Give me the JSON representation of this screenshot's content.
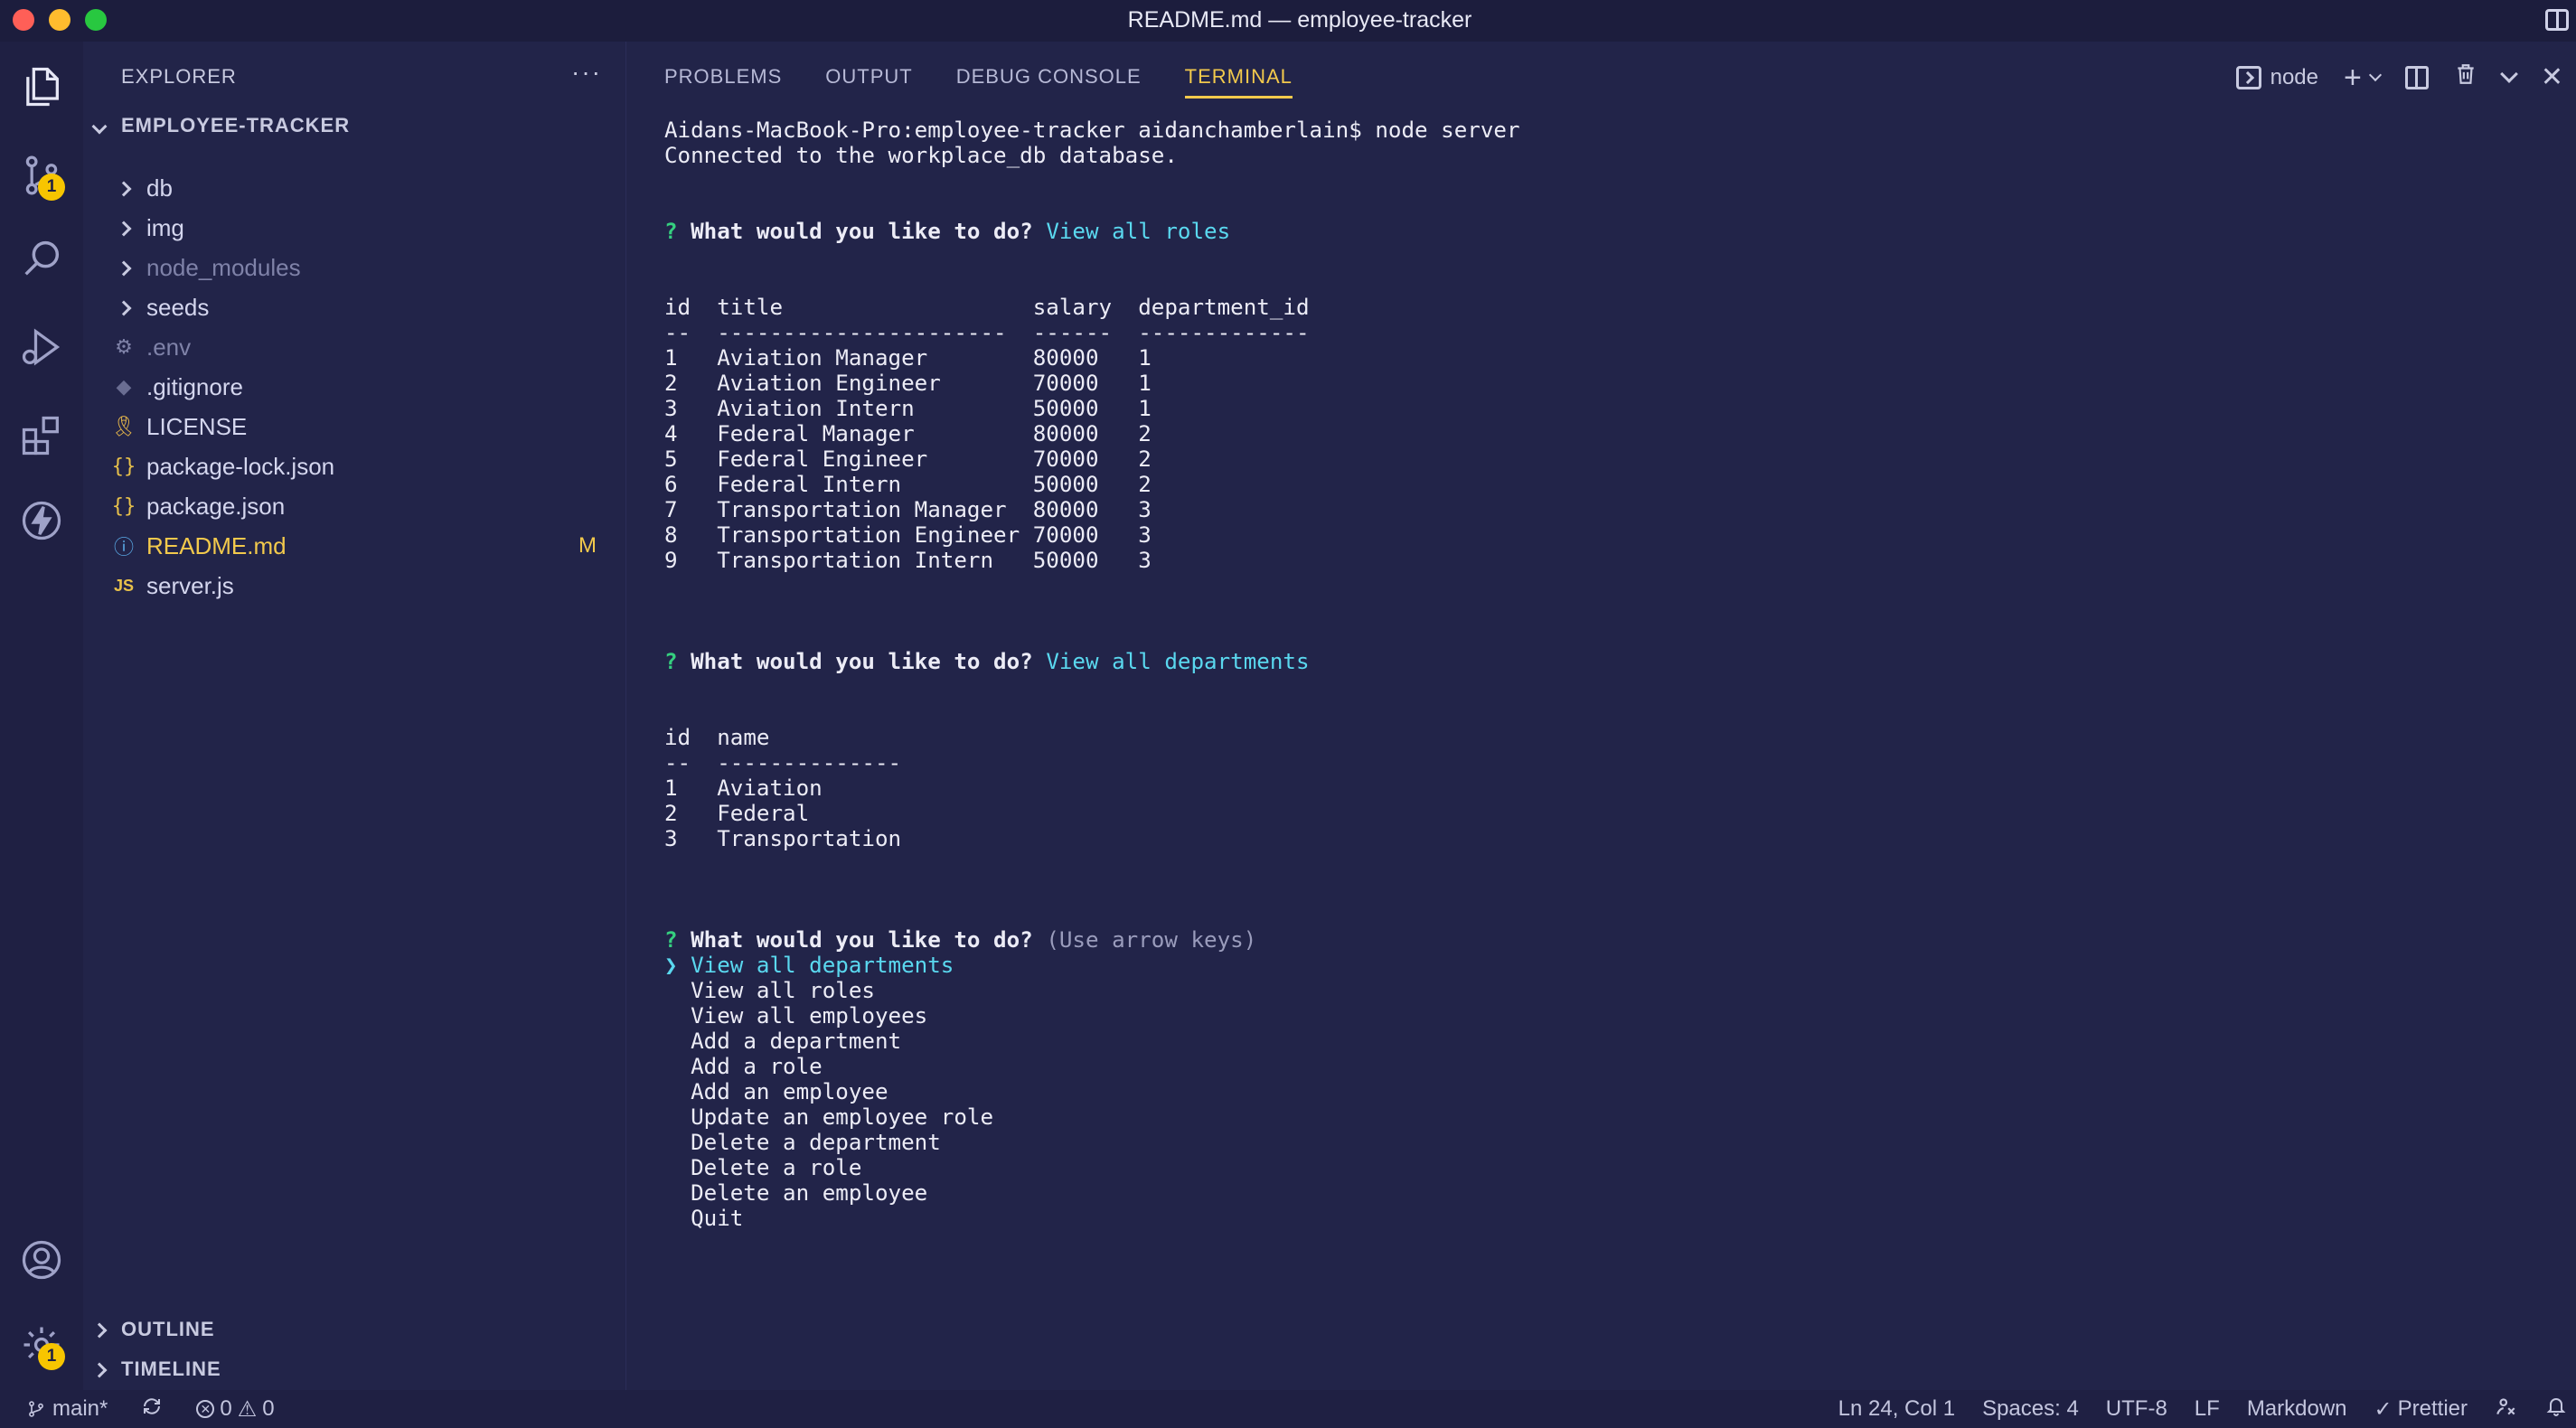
{
  "window": {
    "title": "README.md — employee-tracker"
  },
  "activity": {
    "source_control_badge": "1",
    "settings_badge": "1"
  },
  "explorer": {
    "header": "EXPLORER",
    "more": "···",
    "project": "EMPLOYEE-TRACKER",
    "items": [
      {
        "label": "db",
        "kind": "folder"
      },
      {
        "label": "img",
        "kind": "folder"
      },
      {
        "label": "node_modules",
        "kind": "folder"
      },
      {
        "label": "seeds",
        "kind": "folder"
      },
      {
        "label": ".env",
        "kind": "gear"
      },
      {
        "label": ".gitignore",
        "kind": "git"
      },
      {
        "label": "LICENSE",
        "kind": "license"
      },
      {
        "label": "package-lock.json",
        "kind": "json"
      },
      {
        "label": "package.json",
        "kind": "json"
      },
      {
        "label": "README.md",
        "kind": "info",
        "status": "M"
      },
      {
        "label": "server.js",
        "kind": "js",
        "icon_text": "JS"
      }
    ],
    "outline": "OUTLINE",
    "timeline": "TIMELINE"
  },
  "panel": {
    "tabs": [
      "PROBLEMS",
      "OUTPUT",
      "DEBUG CONSOLE",
      "TERMINAL"
    ],
    "active_tab": "TERMINAL",
    "terminal_name": "node"
  },
  "terminal": {
    "line1": "Aidans-MacBook-Pro:employee-tracker aidanchamberlain$ node server",
    "line2": "Connected to the workplace_db database.",
    "q_mark": "?",
    "prompt": "What would you like to do?",
    "answer_roles": "View all roles",
    "roles_header": "id  title                   salary  department_id",
    "roles_sep": "--  ----------------------  ------  -------------",
    "roles": [
      "1   Aviation Manager        80000   1",
      "2   Aviation Engineer       70000   1",
      "3   Aviation Intern         50000   1",
      "4   Federal Manager         80000   2",
      "5   Federal Engineer        70000   2",
      "6   Federal Intern          50000   2",
      "7   Transportation Manager  80000   3",
      "8   Transportation Engineer 70000   3",
      "9   Transportation Intern   50000   3"
    ],
    "answer_departments": "View all departments",
    "dept_header": "id  name",
    "dept_sep": "--  --------------",
    "departments": [
      "1   Aviation",
      "2   Federal",
      "3   Transportation"
    ],
    "hint": "(Use arrow keys)",
    "pointer": "❯",
    "menu_selected": "View all departments",
    "menu": [
      "View all roles",
      "View all employees",
      "Add a department",
      "Add a role",
      "Add an employee",
      "Update an employee role",
      "Delete a department",
      "Delete a role",
      "Delete an employee",
      "Quit"
    ]
  },
  "status": {
    "branch": "main*",
    "errors": "0",
    "warnings": "0",
    "cursor": "Ln 24, Col 1",
    "spaces": "Spaces: 4",
    "encoding": "UTF-8",
    "eol": "LF",
    "language": "Markdown",
    "formatter": "Prettier"
  }
}
